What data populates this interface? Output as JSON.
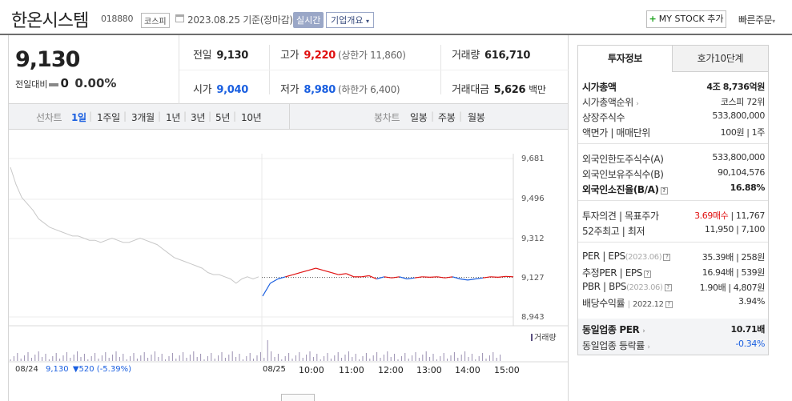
{
  "header": {
    "company_name": "한온시스템",
    "code": "018880",
    "market": "코스피",
    "date": "2023.08.25 기준(장마감)",
    "realtime_label": "실시간",
    "company_info_label": "기업개요",
    "mystock_label": "MY STOCK 추가",
    "quick_order_label": "빠른주문"
  },
  "price": {
    "current": "9,130",
    "change_label": "전일대비",
    "change_value": "0",
    "change_pct": "0.00%"
  },
  "stats": {
    "prev_close_label": "전일",
    "prev_close": "9,130",
    "high_label": "고가",
    "high": "9,220",
    "upper_limit": "(상한가 11,860)",
    "volume_label": "거래량",
    "volume": "616,710",
    "open_label": "시가",
    "open": "9,040",
    "low_label": "저가",
    "low": "8,980",
    "lower_limit": "(하한가 6,400)",
    "amount_label": "거래대금",
    "amount": "5,626",
    "amount_unit": "백만"
  },
  "toolbar": {
    "line_label": "선차트",
    "periods": [
      "1일",
      "1주일",
      "3개월",
      "1년",
      "3년",
      "5년",
      "10년"
    ],
    "candle_label": "봉차트",
    "candles": [
      "일봉",
      "주봉",
      "월봉"
    ]
  },
  "chart_data": {
    "type": "line",
    "y_ticks": [
      "9,681",
      "9,496",
      "9,312",
      "9,127",
      "8,943"
    ],
    "x_ticks": [
      "08/24",
      "08/25",
      "10:00",
      "11:00",
      "12:00",
      "13:00",
      "14:00",
      "15:00"
    ],
    "reference_price": 9127,
    "prev_day_series": [
      9640,
      9560,
      9500,
      9470,
      9440,
      9400,
      9380,
      9360,
      9350,
      9340,
      9330,
      9320,
      9320,
      9310,
      9300,
      9300,
      9290,
      9300,
      9310,
      9300,
      9290,
      9290,
      9300,
      9310,
      9300,
      9290,
      9280,
      9260,
      9240,
      9220,
      9210,
      9200,
      9190,
      9180,
      9170,
      9150,
      9140,
      9140,
      9130,
      9120,
      9100,
      9120,
      9130,
      9120,
      9130
    ],
    "today_series": [
      9040,
      9100,
      9120,
      9130,
      9140,
      9150,
      9160,
      9170,
      9160,
      9150,
      9140,
      9145,
      9130,
      9130,
      9135,
      9120,
      9130,
      9125,
      9130,
      9120,
      9125,
      9130,
      9128,
      9130,
      9125,
      9130,
      9120,
      9115,
      9120,
      9125,
      9130,
      9128,
      9132,
      9130
    ],
    "volume_label": "거래량",
    "legend_date": "08/24",
    "legend_price": "9,130",
    "legend_change": "▼520 (-5.39%)",
    "colors": {
      "prev": "#c8c8c8",
      "up": "#e01010",
      "down": "#1a5fe0",
      "volume": "#9a8fb0"
    }
  },
  "side": {
    "tab_active": "투자정보",
    "tab_other": "호가10단계",
    "rows": [
      {
        "label": "시가총액",
        "value": "4조 8,736억원"
      },
      {
        "label": "시가총액순위",
        "value": "코스피 72위"
      },
      {
        "label": "상장주식수",
        "value": "533,800,000"
      },
      {
        "label": "액면가 | 매매단위",
        "value": "100원 | 1주"
      },
      {
        "label": "외국인한도주식수(A)",
        "value": "533,800,000"
      },
      {
        "label": "외국인보유주식수(B)",
        "value": "90,104,576"
      },
      {
        "label": "외국인소진율(B/A)",
        "value": "16.88%"
      },
      {
        "label": "투자의견 | 목표주가",
        "value_a": "3.69매수",
        "value_b": " | 11,767"
      },
      {
        "label": "52주최고 | 최저",
        "value": "11,950 | 7,100"
      },
      {
        "label": "PER | EPS",
        "note": "(2023.06)",
        "value": "35.39배 | 258원"
      },
      {
        "label": "추정PER | EPS",
        "value": "16.94배 | 539원"
      },
      {
        "label": "PBR | BPS",
        "note": "(2023.06)",
        "value": "1.90배 | 4,807원"
      },
      {
        "label": "배당수익률",
        "note": "2022.12",
        "value": "3.94%"
      },
      {
        "label": "동일업종 PER",
        "value": "10.71배"
      },
      {
        "label": "동일업종 등락률",
        "value": "-0.34%"
      }
    ]
  }
}
